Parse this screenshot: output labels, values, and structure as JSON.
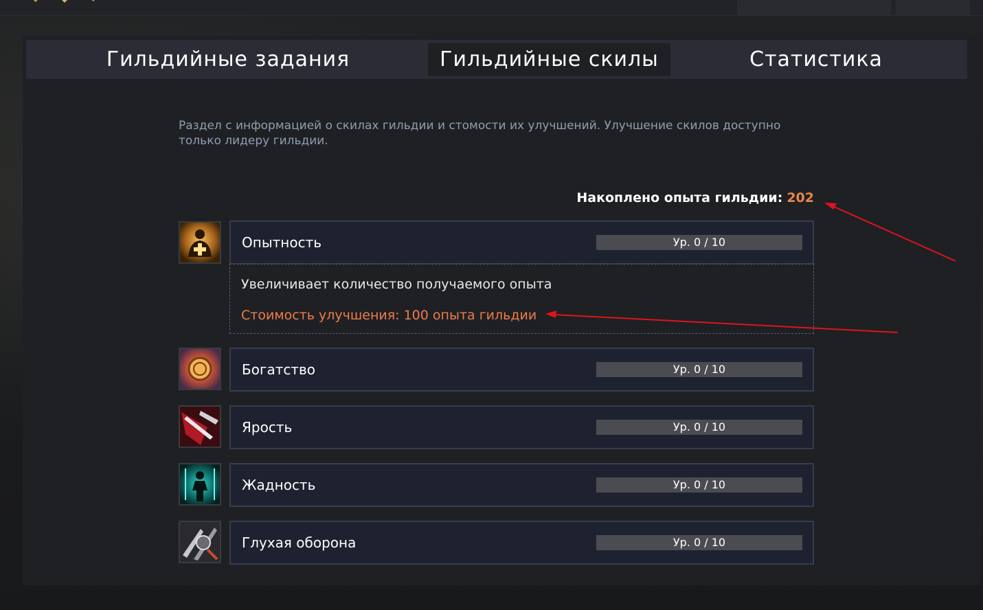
{
  "tabs": [
    {
      "label": "Гильдийные задания"
    },
    {
      "label": "Гильдийные скилы",
      "active": true
    },
    {
      "label": "Статистика"
    }
  ],
  "description": "Раздел с информацией о скилах гильдии и стомости их улучшений. Улучшение скилов доступно только лидеру гильдии.",
  "guild_exp": {
    "label": "Накоплено опыта гильдии:",
    "value": "202"
  },
  "skills": [
    {
      "name": "Опытность",
      "level": "Ур. 0 / 10",
      "icon": "experience-skill-icon",
      "detail": {
        "description": "Увеличивает количество получаемого опыта",
        "cost": "Стоимость улучшения: 100 опыта гильдии"
      }
    },
    {
      "name": "Богатство",
      "level": "Ур. 0 / 10",
      "icon": "wealth-skill-icon"
    },
    {
      "name": "Ярость",
      "level": "Ур. 0 / 10",
      "icon": "fury-skill-icon"
    },
    {
      "name": "Жадность",
      "level": "Ур. 0 / 10",
      "icon": "greed-skill-icon"
    },
    {
      "name": "Глухая оборона",
      "level": "Ур. 0 / 10",
      "icon": "defense-skill-icon"
    }
  ],
  "colors": {
    "accent": "#e8864a",
    "cost": "#f07c4a",
    "annotation_arrow": "#e0141c",
    "description": "#8f9fb2"
  }
}
